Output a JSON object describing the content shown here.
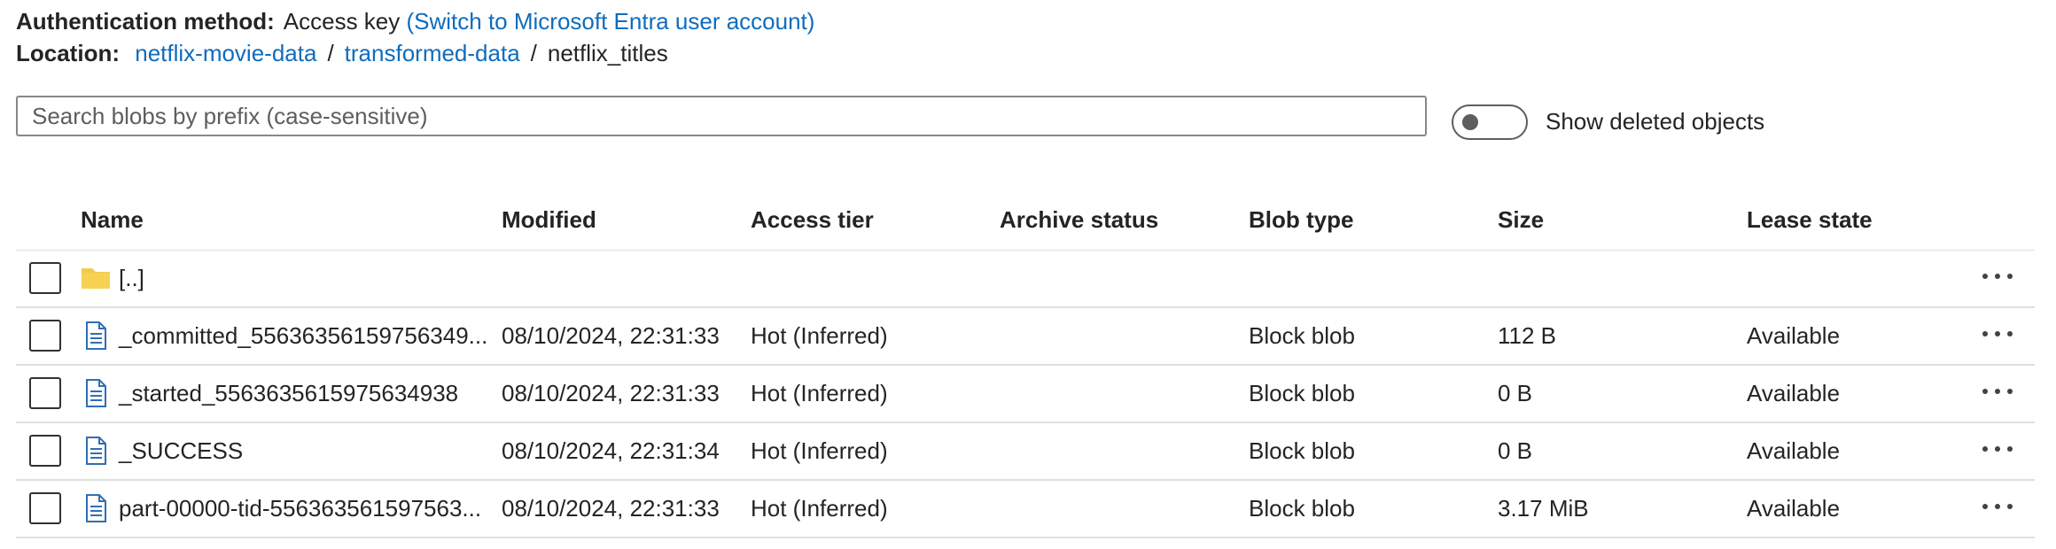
{
  "auth": {
    "label": "Authentication method:",
    "value": "Access key",
    "switch_link": "(Switch to Microsoft Entra user account)"
  },
  "location": {
    "label": "Location:",
    "path": [
      "netflix-movie-data",
      "transformed-data",
      "netflix_titles"
    ],
    "separator": "/"
  },
  "search": {
    "placeholder": "Search blobs by prefix (case-sensitive)",
    "value": ""
  },
  "show_deleted": {
    "label": "Show deleted objects",
    "enabled": false
  },
  "table": {
    "columns": [
      "Name",
      "Modified",
      "Access tier",
      "Archive status",
      "Blob type",
      "Size",
      "Lease state"
    ],
    "rows": [
      {
        "icon": "folder-icon",
        "name": "[..]",
        "modified": "",
        "access_tier": "",
        "archive_status": "",
        "blob_type": "",
        "size": "",
        "lease_state": ""
      },
      {
        "icon": "file-icon",
        "name": "_committed_55636356159756349...",
        "modified": "08/10/2024, 22:31:33",
        "access_tier": "Hot (Inferred)",
        "archive_status": "",
        "blob_type": "Block blob",
        "size": "112 B",
        "lease_state": "Available"
      },
      {
        "icon": "file-icon",
        "name": "_started_5563635615975634938",
        "modified": "08/10/2024, 22:31:33",
        "access_tier": "Hot (Inferred)",
        "archive_status": "",
        "blob_type": "Block blob",
        "size": "0 B",
        "lease_state": "Available"
      },
      {
        "icon": "file-icon",
        "name": "_SUCCESS",
        "modified": "08/10/2024, 22:31:34",
        "access_tier": "Hot (Inferred)",
        "archive_status": "",
        "blob_type": "Block blob",
        "size": "0 B",
        "lease_state": "Available"
      },
      {
        "icon": "file-icon",
        "name": "part-00000-tid-556363561597563...",
        "modified": "08/10/2024, 22:31:33",
        "access_tier": "Hot (Inferred)",
        "archive_status": "",
        "blob_type": "Block blob",
        "size": "3.17 MiB",
        "lease_state": "Available"
      }
    ]
  },
  "colors": {
    "link": "#0f6cbd",
    "text": "#242424",
    "border": "#e1dfdd",
    "folder": "#f2c94c",
    "file": "#2f6fb5"
  }
}
